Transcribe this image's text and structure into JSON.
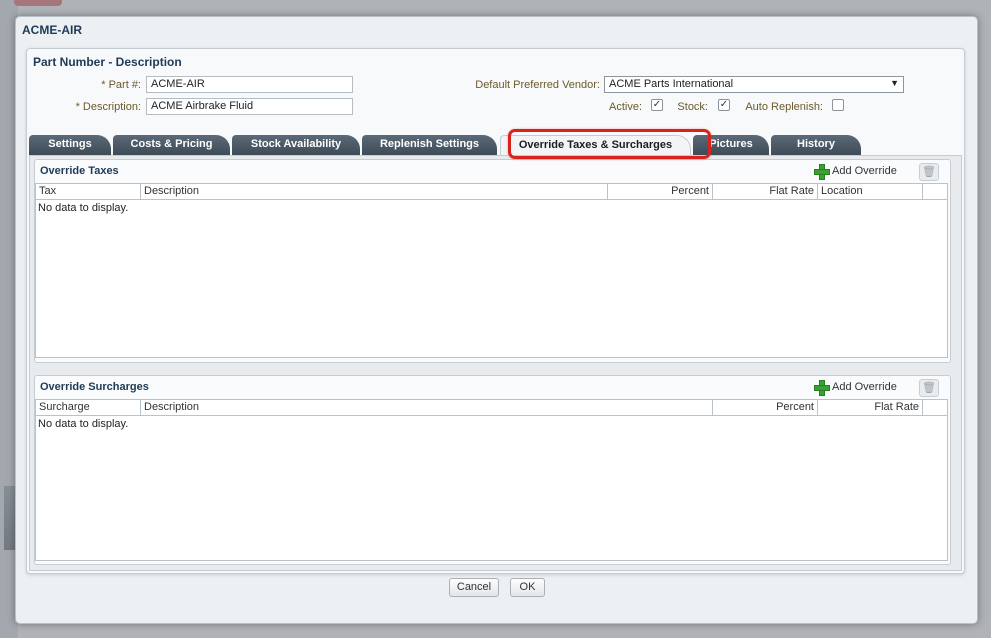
{
  "dialog": {
    "title": "ACME-AIR"
  },
  "panel": {
    "heading": "Part Number - Description",
    "part_label": "* Part #:",
    "part_value": "ACME-AIR",
    "description_label": "* Description:",
    "description_value": "ACME Airbrake Fluid",
    "vendor_label": "Default Preferred Vendor:",
    "vendor_value": "ACME Parts International",
    "active_label": "Active:",
    "active_checked": true,
    "stock_label": "Stock:",
    "stock_checked": true,
    "auto_replenish_label": "Auto Replenish:",
    "auto_replenish_checked": false
  },
  "tabs": [
    {
      "label": "Settings"
    },
    {
      "label": "Costs & Pricing"
    },
    {
      "label": "Stock Availability"
    },
    {
      "label": "Replenish Settings"
    },
    {
      "label": "Override Taxes & Surcharges",
      "active": true
    },
    {
      "label": "Pictures"
    },
    {
      "label": "History"
    }
  ],
  "override_taxes": {
    "title": "Override Taxes",
    "add_label": "Add Override",
    "columns": [
      "Tax",
      "Description",
      "Percent",
      "Flat Rate",
      "Location"
    ],
    "empty_text": "No data to display."
  },
  "override_surcharges": {
    "title": "Override Surcharges",
    "add_label": "Add Override",
    "columns": [
      "Surcharge",
      "Description",
      "Percent",
      "Flat Rate"
    ],
    "empty_text": "No data to display."
  },
  "footer": {
    "cancel_label": "Cancel",
    "ok_label": "OK"
  },
  "colors": {
    "highlight": "#d9221c",
    "tab_dark": "#4a5865",
    "accent_green": "#3aa232"
  },
  "icons": {
    "add": "plus-icon",
    "delete": "trash-icon",
    "dropdown": "chevron-down-icon",
    "check": "checkmark-icon"
  }
}
